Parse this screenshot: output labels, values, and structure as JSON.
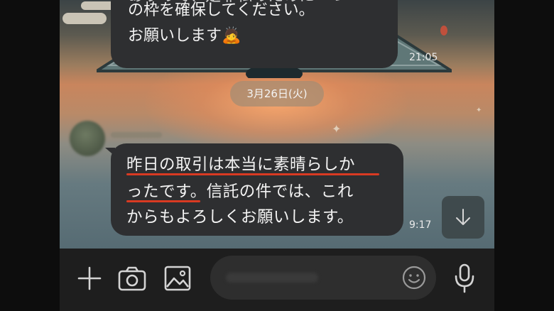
{
  "chat": {
    "prev_message": {
      "lines": [
        "ありので、是非私のために一つ",
        "の枠を確保してください。",
        "お願いします🙇"
      ],
      "time": "21:05"
    },
    "date_separator": "3月26日(火)",
    "message": {
      "lines": [
        "昨日の取引は本当に素晴らしか",
        "ったです。信託の件では、これ",
        "からもよろしくお願いします。"
      ],
      "time": "9:17"
    }
  },
  "icons": {
    "scroll_down": "arrow-down-icon",
    "add": "plus-icon",
    "camera": "camera-icon",
    "gallery": "image-icon",
    "emoji": "smiley-icon",
    "voice": "microphone-icon"
  },
  "colors": {
    "bubble": "#2e2f31",
    "highlight_underline": "#d93a22",
    "input_bar": "#1e1e1e"
  }
}
